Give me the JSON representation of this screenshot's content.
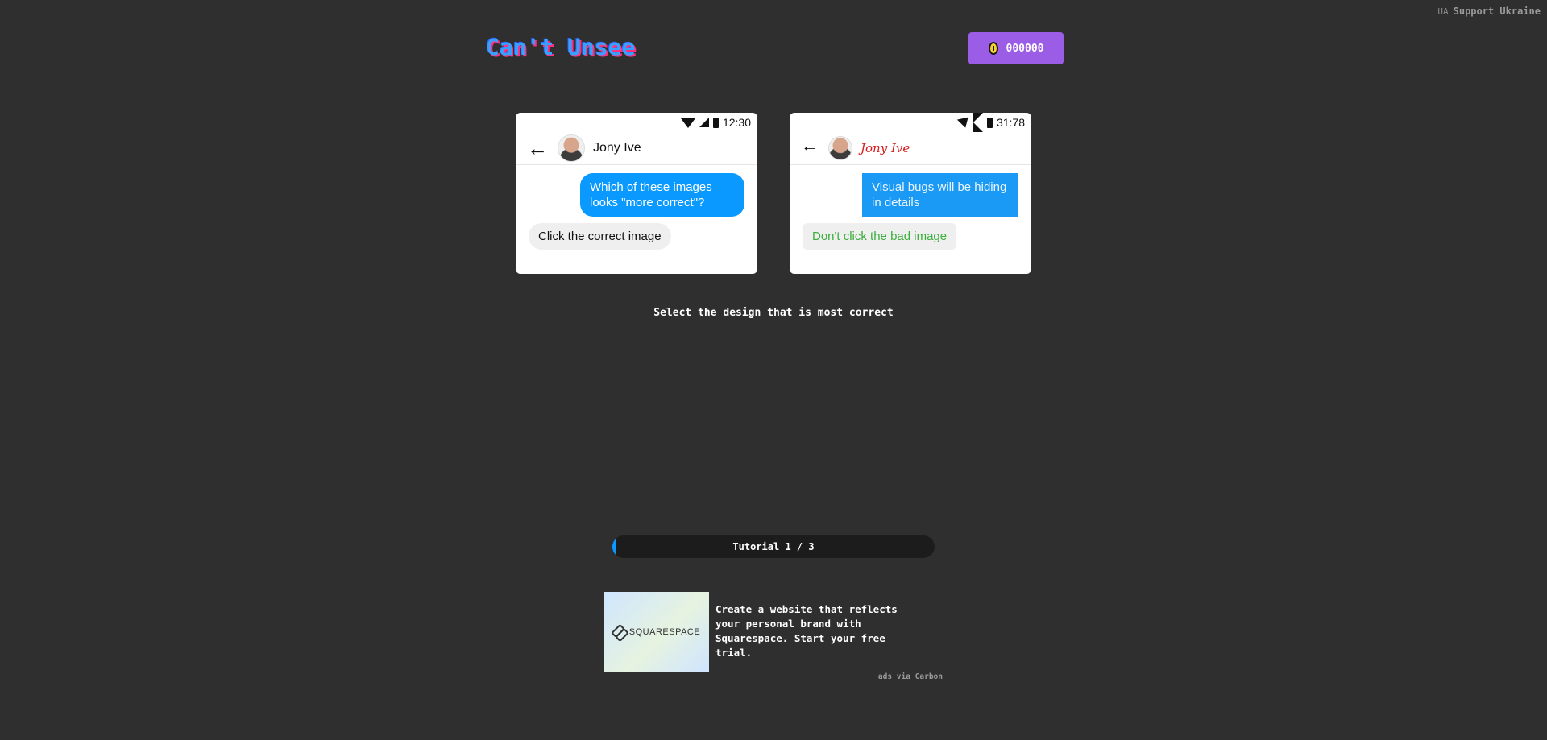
{
  "support": {
    "prefix": "UA",
    "label": "Support Ukraine"
  },
  "header": {
    "logo": "Can't Unsee",
    "coins": "000000",
    "coin_icon": "coin-icon"
  },
  "cards": {
    "left": {
      "time": "12:30",
      "contact": "Jony Ive",
      "outgoing": "Which of these images looks \"more correct\"?",
      "incoming": "Click the correct image"
    },
    "right": {
      "time": "31:78",
      "contact": "Jony Ive",
      "outgoing": "Visual bugs will be hiding in details",
      "incoming": "Don't click the bad image"
    }
  },
  "prompt": "Select the design that is most correct",
  "progress": {
    "label": "Tutorial 1 / 3",
    "fraction": 0.33
  },
  "ad": {
    "brand": "SQUARESPACE",
    "text": "Create a website that reflects your personal brand with Squarespace. Start your free trial.",
    "via": "ads via Carbon"
  },
  "colors": {
    "background": "#2f2f2f",
    "coin_button": "#9b5de5",
    "bubble_blue": "#0a9aff",
    "bad_name_red": "#d42020",
    "bad_text_green": "#3cae3c"
  }
}
